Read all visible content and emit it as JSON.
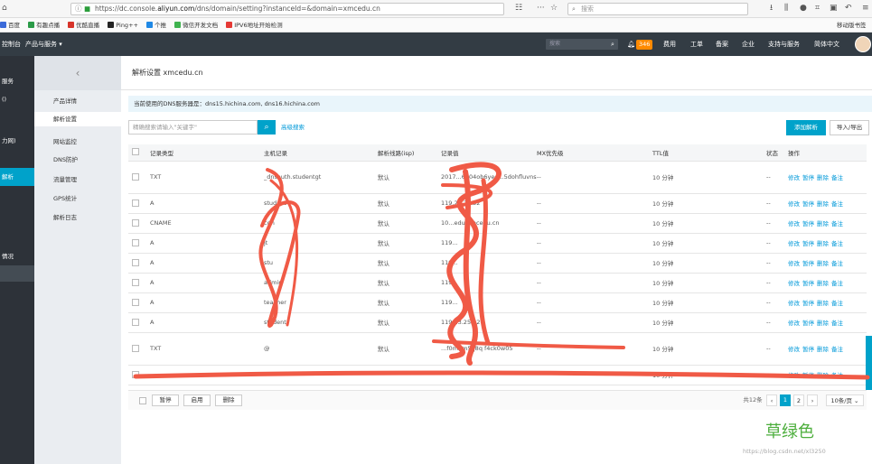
{
  "browser": {
    "url_prefix": "https://dc.console.",
    "url_host": "aliyun.com",
    "url_path": "/dns/domain/setting?instanceId=&domain=xmcedu.cn",
    "search_placeholder": "搜索"
  },
  "bookmarks": [
    "百度",
    "有趣点播",
    "优酷直播",
    "Ping++",
    "个推",
    "微信开发文档",
    "IPV6地址开始检测"
  ],
  "bookmark_right": "移动版书签",
  "topnav": {
    "console_label": "控制台",
    "products_label": "产品与服务 ▾",
    "search_placeholder": "搜索",
    "notify_count": "346",
    "items": [
      "费用",
      "工单",
      "备案",
      "企业",
      "支持与服务",
      "简体中文"
    ]
  },
  "rail": {
    "items": [
      "服务",
      "()",
      "力网)",
      "解析",
      "情况"
    ]
  },
  "subnav": {
    "items": [
      "产品详情",
      "解析设置",
      "网站监控",
      "DNS防护",
      "流量管理",
      "GPS统计",
      "解析日志"
    ],
    "active_index": 1
  },
  "main": {
    "title": "解析设置 xmcedu.cn",
    "notice": "当前使用的DNS服务器是：dns15.hichina.com, dns16.hichina.com",
    "filter_placeholder": "精确搜索请输入\"关键字\"",
    "advanced_search": "高级搜索",
    "add_button": "添加解析",
    "import_button": "导入/导出"
  },
  "table": {
    "headers": [
      "记录类型",
      "主机记录",
      "解析线路(isp)",
      "记录值",
      "MX优先级",
      "TTL值",
      "状态",
      "操作"
    ],
    "rows": [
      {
        "type": "TXT",
        "host": "_dnsauth.studentgt",
        "line": "默认",
        "value": "2017...6n04ob6yed...5dohfluvns6489",
        "mx": "--",
        "ttl": "10 分钟",
        "status": "--",
        "ops": [
          "修改",
          "暂停",
          "删除",
          "备注"
        ]
      },
      {
        "type": "A",
        "host": "student",
        "line": "默认",
        "value": "119.23.25.52",
        "mx": "--",
        "ttl": "10 分钟",
        "status": "--",
        "ops": [
          "修改",
          "暂停",
          "删除",
          "备注"
        ]
      },
      {
        "type": "CNAME",
        "host": "cdn",
        "line": "默认",
        "value": "10...edu.xmcedu.cn",
        "mx": "--",
        "ttl": "10 分钟",
        "status": "--",
        "ops": [
          "修改",
          "暂停",
          "删除",
          "备注"
        ]
      },
      {
        "type": "A",
        "host": "jt",
        "line": "默认",
        "value": "119...",
        "mx": "--",
        "ttl": "10 分钟",
        "status": "--",
        "ops": [
          "修改",
          "暂停",
          "删除",
          "备注"
        ]
      },
      {
        "type": "A",
        "host": "stu",
        "line": "默认",
        "value": "119...",
        "mx": "--",
        "ttl": "10 分钟",
        "status": "--",
        "ops": [
          "修改",
          "暂停",
          "删除",
          "备注"
        ]
      },
      {
        "type": "A",
        "host": "admin",
        "line": "默认",
        "value": "119...",
        "mx": "--",
        "ttl": "10 分钟",
        "status": "--",
        "ops": [
          "修改",
          "暂停",
          "删除",
          "备注"
        ]
      },
      {
        "type": "A",
        "host": "teacher",
        "line": "默认",
        "value": "119...",
        "mx": "--",
        "ttl": "10 分钟",
        "status": "--",
        "ops": [
          "修改",
          "暂停",
          "删除",
          "备注"
        ]
      },
      {
        "type": "A",
        "host": "student",
        "line": "默认",
        "value": "119.23.25.52",
        "mx": "--",
        "ttl": "10 分钟",
        "status": "--",
        "ops": [
          "修改",
          "暂停",
          "删除",
          "备注"
        ]
      },
      {
        "type": "TXT",
        "host": "@",
        "line": "默认",
        "value": "...f0m9m5q8q f4ck0w05",
        "mx": "--",
        "ttl": "10 分钟",
        "status": "--",
        "ops": [
          "修改",
          "暂停",
          "删除",
          "备注"
        ]
      },
      {
        "type": "",
        "host": "",
        "line": "",
        "value": "",
        "mx": "--",
        "ttl": "10 分钟",
        "status": "--",
        "ops": [
          "修改",
          "暂停",
          "删除",
          "备注"
        ]
      }
    ]
  },
  "footer": {
    "pause": "暂停",
    "enable": "启用",
    "delete": "删除",
    "total": "共12条",
    "pages": [
      "1",
      "2"
    ],
    "current_page": "1",
    "page_size": "10条/页"
  },
  "watermark": {
    "caption": "草绿色",
    "url": "https://blog.csdn.net/xl3250"
  },
  "colors": {
    "accent": "#00a2ca",
    "topnav_bg": "#333c44",
    "rail_bg": "#2d3239",
    "scribble": "#f05a46",
    "caption": "#4cae3c"
  }
}
